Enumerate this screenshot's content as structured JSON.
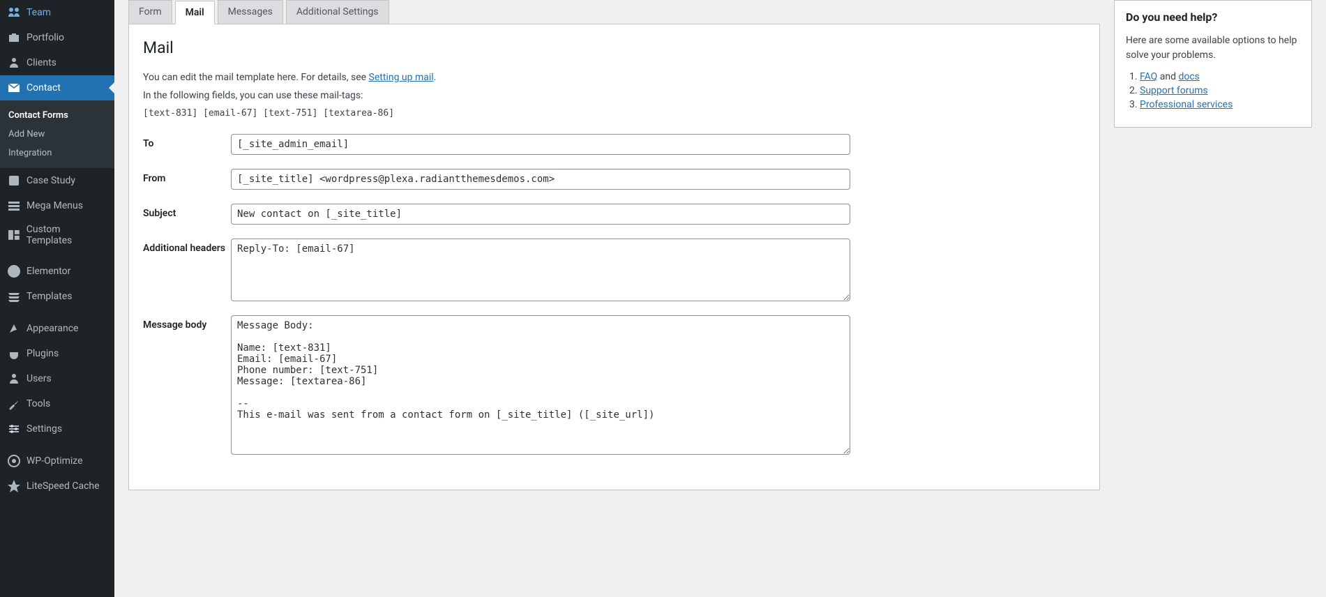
{
  "sidebar": {
    "items": [
      {
        "label": "Team"
      },
      {
        "label": "Portfolio"
      },
      {
        "label": "Clients"
      },
      {
        "label": "Contact"
      },
      {
        "label": "Case Study"
      },
      {
        "label": "Mega Menus"
      },
      {
        "label": "Custom Templates"
      },
      {
        "label": "Elementor"
      },
      {
        "label": "Templates"
      },
      {
        "label": "Appearance"
      },
      {
        "label": "Plugins"
      },
      {
        "label": "Users"
      },
      {
        "label": "Tools"
      },
      {
        "label": "Settings"
      },
      {
        "label": "WP-Optimize"
      },
      {
        "label": "LiteSpeed Cache"
      }
    ],
    "submenu": {
      "contact_forms": "Contact Forms",
      "add_new": "Add New",
      "integration": "Integration"
    }
  },
  "tabs": {
    "form": "Form",
    "mail": "Mail",
    "messages": "Messages",
    "additional": "Additional Settings"
  },
  "panel": {
    "heading": "Mail",
    "intro1_pre": "You can edit the mail template here. For details, see ",
    "intro1_link": "Setting up mail",
    "intro1_post": ".",
    "intro2": "In the following fields, you can use these mail-tags:",
    "mailtags": "[text-831] [email-67] [text-751] [textarea-86]",
    "labels": {
      "to": "To",
      "from": "From",
      "subject": "Subject",
      "additional_headers": "Additional headers",
      "message_body": "Message body"
    },
    "values": {
      "to": "[_site_admin_email]",
      "from": "[_site_title] <wordpress@plexa.radiantthemesdemos.com>",
      "subject": "New contact on [_site_title]",
      "additional_headers": "Reply-To: [email-67]",
      "message_body": "Message Body:\n\nName: [text-831]\nEmail: [email-67]\nPhone number: [text-751]\nMessage: [textarea-86]\n\n--\nThis e-mail was sent from a contact form on [_site_title] ([_site_url])"
    }
  },
  "help": {
    "title": "Do you need help?",
    "intro": "Here are some available options to help solve your problems.",
    "faq": "FAQ",
    "and": " and ",
    "docs": "docs",
    "support": "Support forums",
    "pro": "Professional services"
  }
}
